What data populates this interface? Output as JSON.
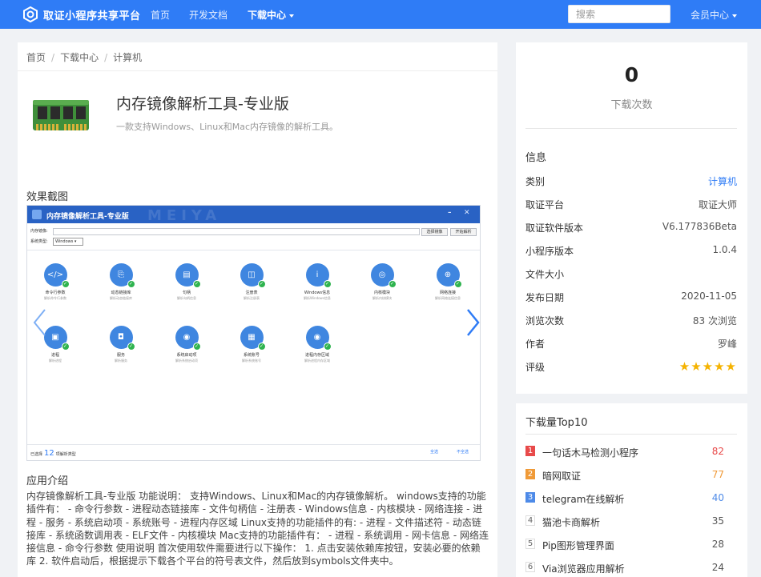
{
  "colors": {
    "brand": "#2f7cf6",
    "star": "#f5b301",
    "rank1": "#e84a4a",
    "rank2": "#f09a37",
    "rank3": "#4d8ae8"
  },
  "nav": {
    "brand": "取证小程序共享平台",
    "items": [
      "首页",
      "开发文档",
      "下载中心"
    ],
    "search_placeholder": "搜索",
    "member": "会员中心"
  },
  "breadcrumb": [
    "首页",
    "下载中心",
    "计算机"
  ],
  "app": {
    "icon": "memory-chip-icon",
    "title": "内存镜像解析工具-专业版",
    "desc": "一款支持Windows、Linux和Mac内存镜像的解析工具。"
  },
  "screenshot_section": "效果截图",
  "shot": {
    "window_title": "内存镜像解析工具-专业版",
    "watermark": "MEIYA",
    "image_label": "内存镜像:",
    "btn_select": "选择镜像",
    "btn_start": "开始解析",
    "sys_label": "系统类型:",
    "sys_value": "Windows",
    "modules": [
      {
        "name": "命令行参数",
        "desc": "解析命令行参数",
        "icon": "</>"
      },
      {
        "name": "动态链接库",
        "desc": "解析动态链接库",
        "icon": "⎘"
      },
      {
        "name": "句柄",
        "desc": "解析句柄信息",
        "icon": "▤"
      },
      {
        "name": "注册表",
        "desc": "解析注册表",
        "icon": "◫"
      },
      {
        "name": "Windows信息",
        "desc": "解析Windows信息",
        "icon": "i"
      },
      {
        "name": "内核模块",
        "desc": "解析内核模块",
        "icon": "◎"
      },
      {
        "name": "网络连接",
        "desc": "解析网络连接信息",
        "icon": "⊕"
      },
      {
        "name": "进程",
        "desc": "解析进程",
        "icon": "▣"
      },
      {
        "name": "服务",
        "desc": "解析服务",
        "icon": "◘"
      },
      {
        "name": "系统启动项",
        "desc": "解析系统启动项",
        "icon": "◉"
      },
      {
        "name": "系统账号",
        "desc": "解析系统账号",
        "icon": "▦"
      },
      {
        "name": "进程内存区域",
        "desc": "解析进程内存区域",
        "icon": "◉"
      }
    ],
    "bottom_prefix": "已选择",
    "bottom_count": "12",
    "bottom_suffix": "项解析类型",
    "link_all": "全选",
    "link_none": "不全选"
  },
  "intro_section": "应用介绍",
  "intro_text": "内存镜像解析工具-专业版 功能说明： 支持Windows、Linux和Mac的内存镜像解析。 windows支持的功能插件有： - 命令行参数 - 进程动态链接库 - 文件句柄信 - 注册表 - Windows信息 - 内核模块 - 网络连接 - 进程 - 服务 - 系统启动项 - 系统账号 - 进程内存区域 Linux支持的功能插件的有: - 进程 - 文件描述符 - 动态链接库 - 系统函数调用表 - ELF文件 - 内核模块 Mac支持的功能插件有： - 进程 - 系统调用 - 网卡信息 - 网络连接信息 - 命令行参数 使用说明 首次使用软件需要进行以下操作： 1. 点击安装依赖库按钮，安装必要的依赖库 2. 软件启动后，根据提示下载各个平台的符号表文件，然后放到symbols文件夹中。",
  "stats": {
    "count": "0",
    "label": "下载次数"
  },
  "info": {
    "title": "信息",
    "rows": [
      {
        "k": "类别",
        "v": "计算机"
      },
      {
        "k": "取证平台",
        "v": "取证大师"
      },
      {
        "k": "取证软件版本",
        "v": "V6.177836Beta"
      },
      {
        "k": "小程序版本",
        "v": "1.0.4"
      },
      {
        "k": "文件大小",
        "v": ""
      },
      {
        "k": "发布日期",
        "v": "2020-11-05"
      },
      {
        "k": "浏览次数",
        "v": "83 次浏览"
      },
      {
        "k": "作者",
        "v": "罗峰"
      },
      {
        "k": "评级",
        "v": ""
      }
    ],
    "rating": 5,
    "rating_max": 5
  },
  "top10": {
    "title": "下载量Top10",
    "items": [
      {
        "rank": "1",
        "name": "一句话木马检测小程序",
        "count": "82"
      },
      {
        "rank": "2",
        "name": "暗网取证",
        "count": "77"
      },
      {
        "rank": "3",
        "name": "telegram在线解析",
        "count": "40"
      },
      {
        "rank": "4",
        "name": "猫池卡商解析",
        "count": "35"
      },
      {
        "rank": "5",
        "name": "Pip图形管理界面",
        "count": "28"
      },
      {
        "rank": "6",
        "name": "Via浏览器应用解析",
        "count": "24"
      }
    ]
  }
}
